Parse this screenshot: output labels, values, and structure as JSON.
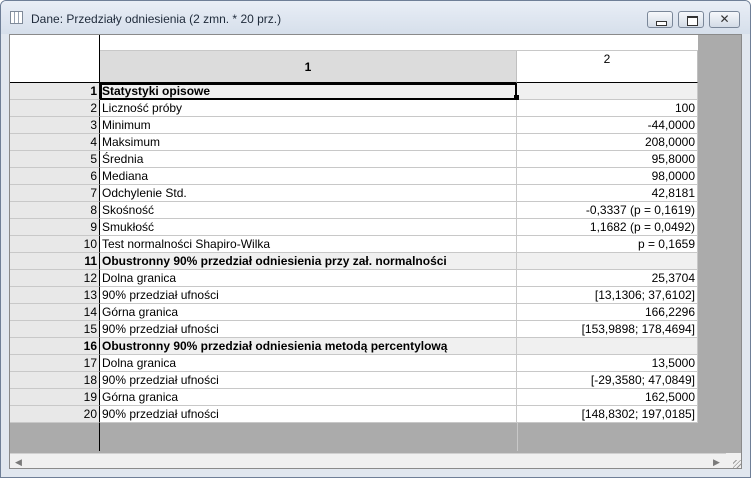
{
  "window": {
    "title": "Dane: Przedziały odniesienia (2 zmn. * 20 prz.)",
    "close_glyph": "✕"
  },
  "columns": [
    {
      "label": "1"
    },
    {
      "label": "2"
    }
  ],
  "rows": [
    {
      "n": "1",
      "label": "Statystyki opisowe",
      "value": ""
    },
    {
      "n": "2",
      "label": "Liczność próby",
      "value": "100"
    },
    {
      "n": "3",
      "label": "Minimum",
      "value": "-44,0000"
    },
    {
      "n": "4",
      "label": "Maksimum",
      "value": "208,0000"
    },
    {
      "n": "5",
      "label": "Średnia",
      "value": "95,8000"
    },
    {
      "n": "6",
      "label": "Mediana",
      "value": "98,0000"
    },
    {
      "n": "7",
      "label": "Odchylenie Std.",
      "value": "42,8181"
    },
    {
      "n": "8",
      "label": "Skośność",
      "value": "-0,3337 (p = 0,1619)"
    },
    {
      "n": "9",
      "label": "Smukłość",
      "value": "1,1682 (p = 0,0492)"
    },
    {
      "n": "10",
      "label": "Test normalności Shapiro-Wilka",
      "value": "p = 0,1659"
    },
    {
      "n": "11",
      "label": "Obustronny 90% przedział odniesienia przy zał. normalności",
      "value": ""
    },
    {
      "n": "12",
      "label": "Dolna granica",
      "value": "25,3704"
    },
    {
      "n": "13",
      "label": "90% przedział ufności",
      "value": "[13,1306; 37,6102]"
    },
    {
      "n": "14",
      "label": "Górna granica",
      "value": "166,2296"
    },
    {
      "n": "15",
      "label": "90% przedział ufności",
      "value": "[153,9898; 178,4694]"
    },
    {
      "n": "16",
      "label": "Obustronny 90% przedział odniesienia metodą percentylową",
      "value": ""
    },
    {
      "n": "17",
      "label": "Dolna granica",
      "value": "13,5000"
    },
    {
      "n": "18",
      "label": "90% przedział ufności",
      "value": "[-29,3580; 47,0849]"
    },
    {
      "n": "19",
      "label": "Górna granica",
      "value": "162,5000"
    },
    {
      "n": "20",
      "label": "90% przedział ufności",
      "value": "[148,8302; 197,0185]"
    }
  ],
  "scrollbar": {
    "left_arrow": "◀",
    "right_arrow": "▶"
  }
}
